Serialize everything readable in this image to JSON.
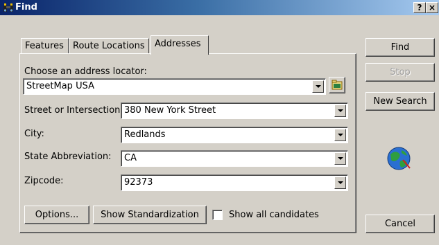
{
  "window": {
    "title": "Find",
    "help_label": "?",
    "close_label": "×",
    "binoculars_icon": "binoculars-icon",
    "globe_icon": "globe-icon"
  },
  "tabs": [
    {
      "label": "Features",
      "active": false
    },
    {
      "label": "Route Locations",
      "active": false
    },
    {
      "label": "Addresses",
      "active": true
    }
  ],
  "locator": {
    "label": "Choose an address locator:",
    "value": "StreetMap USA"
  },
  "fields": {
    "street": {
      "label": "Street or Intersection:",
      "value": "380 New York Street"
    },
    "city": {
      "label": "City:",
      "value": "Redlands"
    },
    "state": {
      "label": "State Abbreviation:",
      "value": "CA"
    },
    "zip": {
      "label": "Zipcode:",
      "value": "92373"
    }
  },
  "buttons": {
    "options": "Options...",
    "standardize": "Show Standardization",
    "show_all": "Show all candidates",
    "find": "Find",
    "stop": "Stop",
    "new_search": "New Search",
    "cancel": "Cancel"
  },
  "colors": {
    "title_start": "#0a246a",
    "title_end": "#a6caf0",
    "face": "#d4d0c8"
  }
}
